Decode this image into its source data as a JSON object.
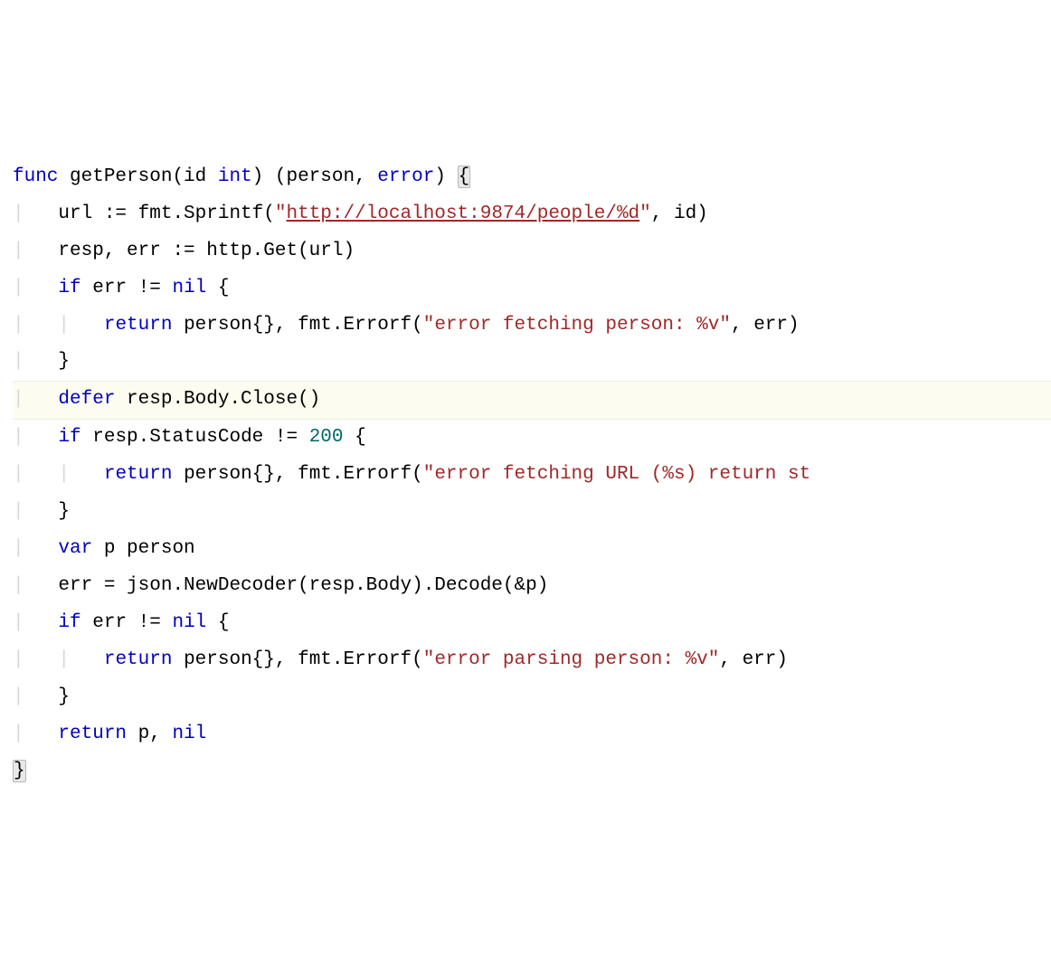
{
  "code": {
    "lines": [
      {
        "indent": 0,
        "highlighted": false,
        "segments": [
          {
            "t": "func",
            "c": "kw"
          },
          {
            "t": " getPerson(id ",
            "c": ""
          },
          {
            "t": "int",
            "c": "type"
          },
          {
            "t": ") (person, ",
            "c": ""
          },
          {
            "t": "error",
            "c": "type"
          },
          {
            "t": ") ",
            "c": ""
          },
          {
            "t": "{",
            "c": "brace-highlight"
          }
        ]
      },
      {
        "indent": 1,
        "highlighted": false,
        "segments": [
          {
            "t": "url := fmt.Sprintf(",
            "c": ""
          },
          {
            "t": "\"",
            "c": "str"
          },
          {
            "t": "http://localhost:9874/people/%d",
            "c": "url"
          },
          {
            "t": "\"",
            "c": "str"
          },
          {
            "t": ", id)",
            "c": ""
          }
        ]
      },
      {
        "indent": 1,
        "highlighted": false,
        "segments": [
          {
            "t": "resp, err := http.Get(url)",
            "c": ""
          }
        ]
      },
      {
        "indent": 1,
        "highlighted": false,
        "segments": [
          {
            "t": "if",
            "c": "kw"
          },
          {
            "t": " err != ",
            "c": ""
          },
          {
            "t": "nil",
            "c": "kw"
          },
          {
            "t": " {",
            "c": ""
          }
        ]
      },
      {
        "indent": 2,
        "highlighted": false,
        "segments": [
          {
            "t": "return",
            "c": "kw"
          },
          {
            "t": " person{}, fmt.Errorf(",
            "c": ""
          },
          {
            "t": "\"error fetching person: %v\"",
            "c": "str"
          },
          {
            "t": ", err)",
            "c": ""
          }
        ]
      },
      {
        "indent": 1,
        "highlighted": false,
        "segments": [
          {
            "t": "}",
            "c": ""
          }
        ]
      },
      {
        "indent": 1,
        "highlighted": true,
        "segments": [
          {
            "t": "defer",
            "c": "kw"
          },
          {
            "t": " resp.Body.Close()",
            "c": ""
          }
        ]
      },
      {
        "indent": 1,
        "highlighted": false,
        "segments": [
          {
            "t": "if",
            "c": "kw"
          },
          {
            "t": " resp.StatusCode != ",
            "c": ""
          },
          {
            "t": "200",
            "c": "num"
          },
          {
            "t": " {",
            "c": ""
          }
        ]
      },
      {
        "indent": 2,
        "highlighted": false,
        "segments": [
          {
            "t": "return",
            "c": "kw"
          },
          {
            "t": " person{}, fmt.Errorf(",
            "c": ""
          },
          {
            "t": "\"error fetching URL (%s) return st",
            "c": "str"
          }
        ]
      },
      {
        "indent": 1,
        "highlighted": false,
        "segments": [
          {
            "t": "}",
            "c": ""
          }
        ]
      },
      {
        "indent": 1,
        "highlighted": false,
        "segments": [
          {
            "t": "var",
            "c": "kw"
          },
          {
            "t": " p person",
            "c": ""
          }
        ]
      },
      {
        "indent": 1,
        "highlighted": false,
        "segments": [
          {
            "t": "err = json.NewDecoder(resp.Body).Decode(&p)",
            "c": ""
          }
        ]
      },
      {
        "indent": 1,
        "highlighted": false,
        "segments": [
          {
            "t": "if",
            "c": "kw"
          },
          {
            "t": " err != ",
            "c": ""
          },
          {
            "t": "nil",
            "c": "kw"
          },
          {
            "t": " {",
            "c": ""
          }
        ]
      },
      {
        "indent": 2,
        "highlighted": false,
        "segments": [
          {
            "t": "return",
            "c": "kw"
          },
          {
            "t": " person{}, fmt.Errorf(",
            "c": ""
          },
          {
            "t": "\"error parsing person: %v\"",
            "c": "str"
          },
          {
            "t": ", err)",
            "c": ""
          }
        ]
      },
      {
        "indent": 1,
        "highlighted": false,
        "segments": [
          {
            "t": "}",
            "c": ""
          }
        ]
      },
      {
        "indent": 1,
        "highlighted": false,
        "segments": [
          {
            "t": "return",
            "c": "kw"
          },
          {
            "t": " p, ",
            "c": ""
          },
          {
            "t": "nil",
            "c": "kw"
          }
        ]
      },
      {
        "indent": 0,
        "highlighted": false,
        "segments": [
          {
            "t": "}",
            "c": "brace-highlight"
          }
        ]
      }
    ],
    "indentSize": 4
  }
}
